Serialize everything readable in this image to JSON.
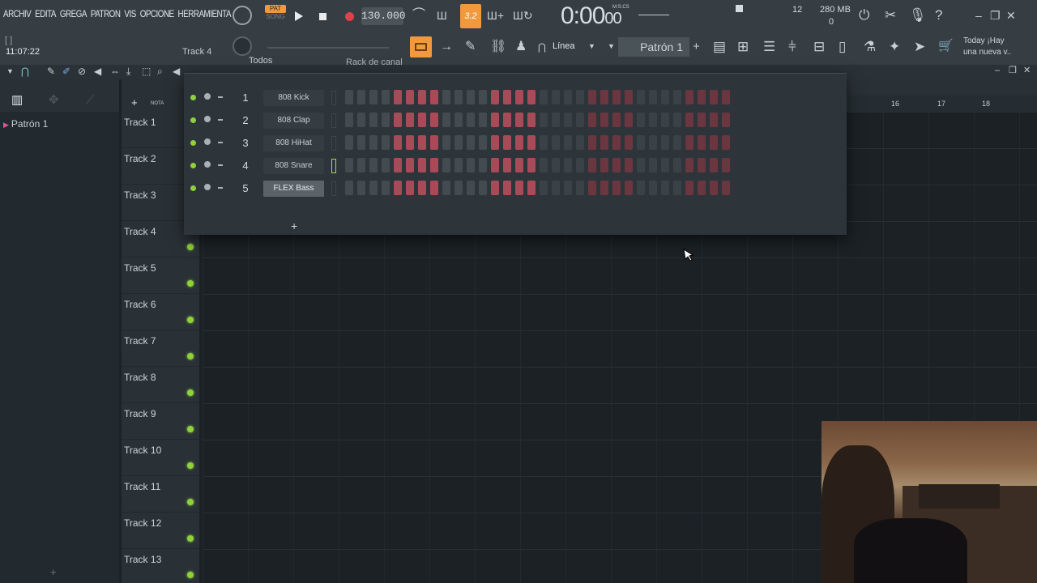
{
  "menu": [
    "ARCHIV",
    "EDITA",
    "GREGA",
    "PATRON",
    "VIS",
    "OPCIONE",
    "HERRAMIENTA"
  ],
  "status": {
    "brackets": "[  ]",
    "clock": "11:07:22",
    "hint_track": "Track 4"
  },
  "transport": {
    "pat_label": "PAT",
    "song_label": "SONG",
    "tempo": "130.000",
    "step_badge": "3.2"
  },
  "time": {
    "main": "0:00",
    "small": "00",
    "format": "M:S:CS"
  },
  "system": {
    "cpu": "12",
    "memory": "280 MB",
    "memory2": "0"
  },
  "news": {
    "line1": "Today  ¡Hay",
    "line2": "una nueva v.."
  },
  "toolbar": {
    "snap_label": "Línea",
    "pattern_label": "Patrón 1",
    "pattern_add": "+"
  },
  "browser": {
    "item": "Patrón 1"
  },
  "rack": {
    "filter": "Todos",
    "title": "Rack de canal",
    "channels": [
      {
        "num": "1",
        "name": "808 Kick",
        "selected": false
      },
      {
        "num": "2",
        "name": "808 Clap",
        "selected": false
      },
      {
        "num": "3",
        "name": "808 HiHat",
        "selected": false
      },
      {
        "num": "4",
        "name": "808 Snare",
        "selected": false
      },
      {
        "num": "5",
        "name": "FLEX Bass",
        "selected": true
      }
    ],
    "add": "+"
  },
  "playlist": {
    "tracks": [
      "Track 1",
      "Track 2",
      "Track 3",
      "Track 4",
      "Track 5",
      "Track 6",
      "Track 7",
      "Track 8",
      "Track 9",
      "Track 10",
      "Track 11",
      "Track 12",
      "Track 13"
    ],
    "bar_numbers": [
      "16",
      "17",
      "18"
    ],
    "tool_label": "NOTA"
  },
  "colors": {
    "accent": "#f19a3d",
    "led": "#8fd13b",
    "step_on": "#a94a58"
  }
}
